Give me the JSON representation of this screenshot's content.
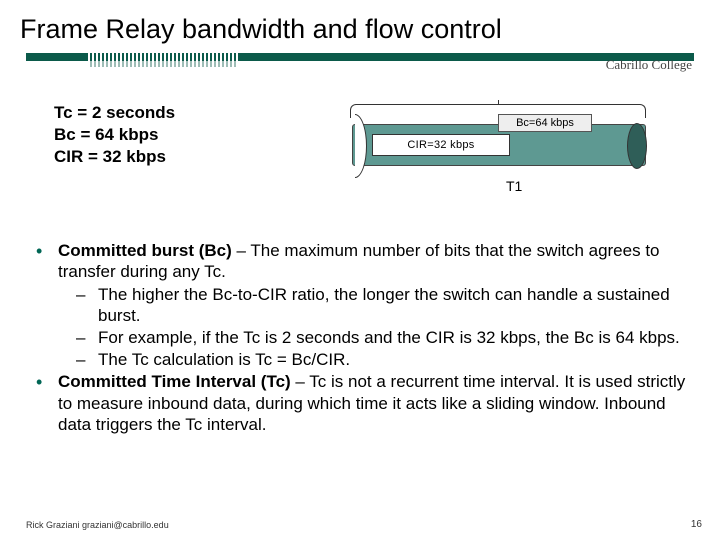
{
  "title": "Frame Relay bandwidth and flow control",
  "brand": "Cabrillo College",
  "params": {
    "tc": "Tc = 2 seconds",
    "bc": "Bc = 64 kbps",
    "cir": "CIR = 32 kbps"
  },
  "diagram": {
    "bc_label": "Bc=64 kbps",
    "cir_label": "CIR=32 kbps",
    "link_label": "T1"
  },
  "bullets": [
    {
      "term": "Committed burst (Bc)",
      "rest": " – The maximum number of bits that the switch agrees to transfer during any Tc.",
      "subs": [
        "The higher the Bc-to-CIR ratio, the longer the switch can handle a sustained burst.",
        "For example, if the Tc is 2 seconds and the CIR is 32 kbps, the Bc is 64 kbps.",
        "The Tc calculation is Tc = Bc/CIR."
      ]
    },
    {
      "term": "Committed Time Interval (Tc)",
      "rest": " – Tc is not a recurrent time interval. It is used strictly to measure inbound data, during which time it acts like a sliding window. Inbound data triggers the Tc interval.",
      "subs": []
    }
  ],
  "footer": {
    "author": "Rick Graziani graziani@cabrillo.edu",
    "page": "16"
  }
}
